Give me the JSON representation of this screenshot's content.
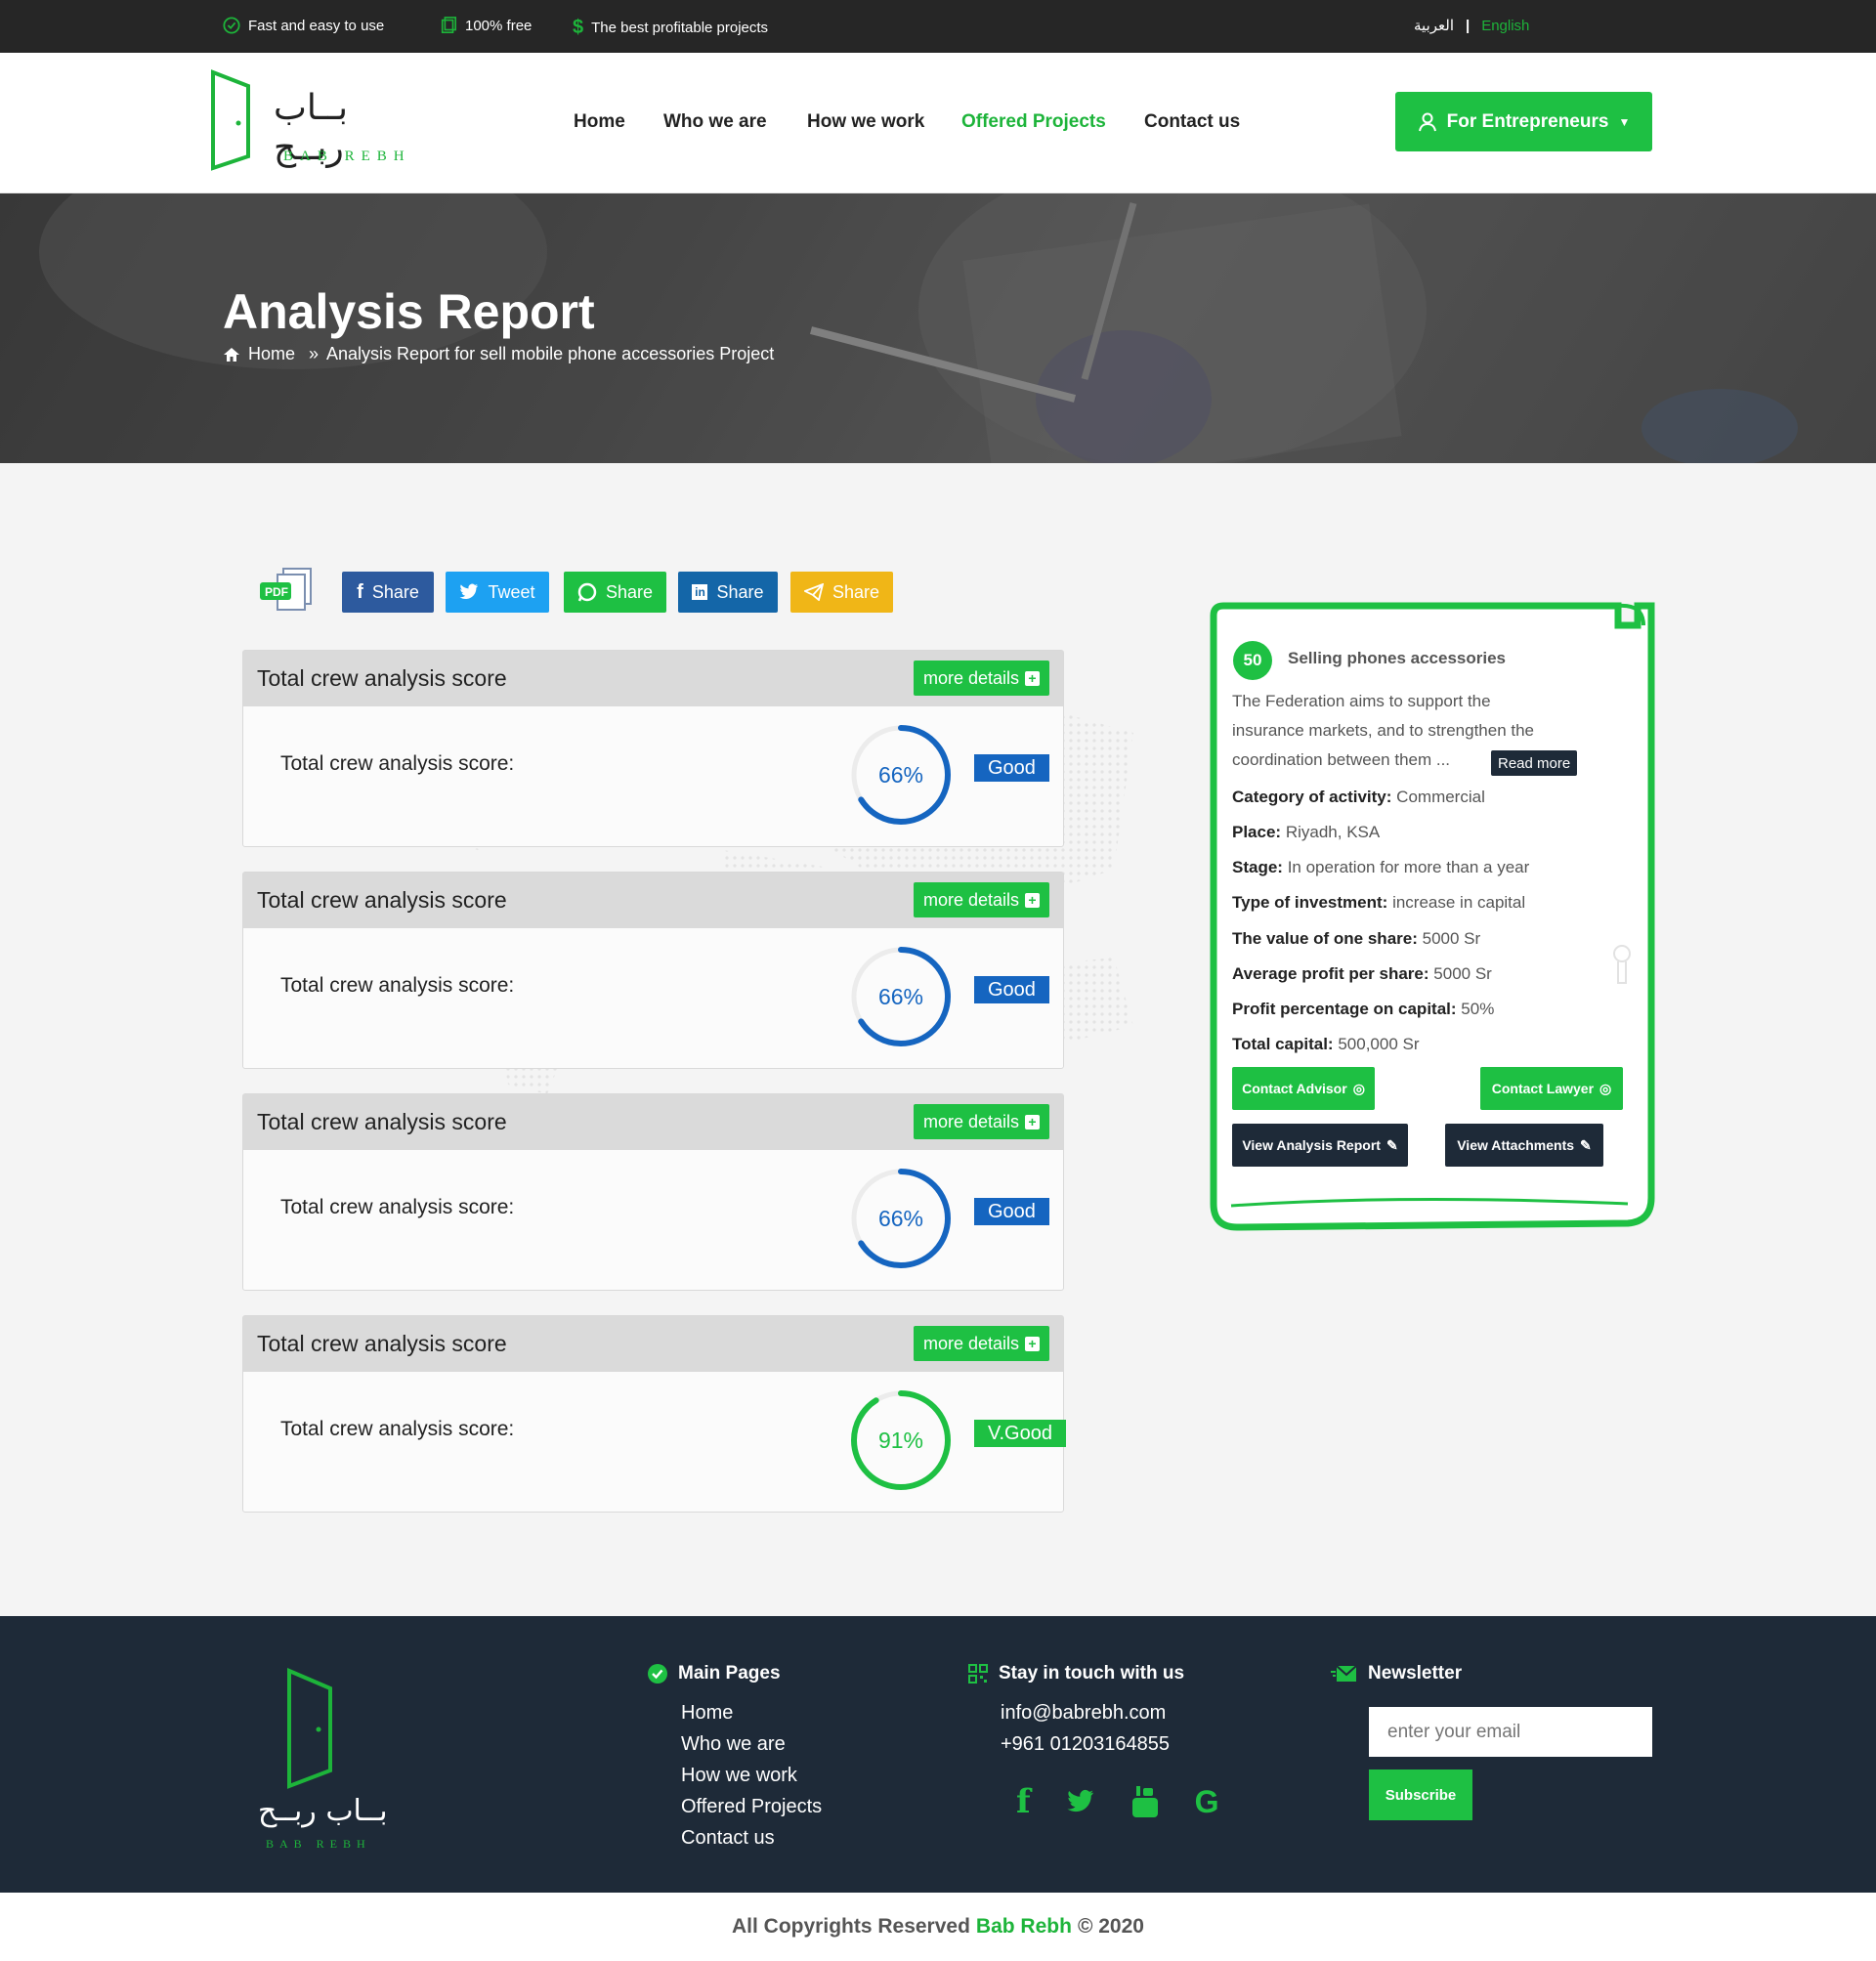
{
  "topbar": {
    "feature1": "Fast and easy to use",
    "feature2": "100% free",
    "feature3": "The best profitable projects",
    "lang_ar": "العربية",
    "lang_sep": "|",
    "lang_en": "English"
  },
  "brand": {
    "name_ar": "بــاب ربــح",
    "name_en": "BAB REBH"
  },
  "nav": {
    "home": "Home",
    "who": "Who we are",
    "how": "How we work",
    "offered": "Offered Projects",
    "contact": "Contact us",
    "cta": "For Entrepreneurs"
  },
  "hero": {
    "title": "Analysis Report",
    "crumb_home": "Home",
    "crumb_current": "Analysis Report for sell mobile phone accessories Project"
  },
  "share": {
    "pdf": "PDF",
    "facebook": "Share",
    "twitter": "Tweet",
    "whatsapp": "Share",
    "linkedin": "Share",
    "telegram": "Share"
  },
  "cards": [
    {
      "title": "Total crew analysis score",
      "more": "more details",
      "label": "Total crew analysis score:",
      "score": "66%",
      "value": 0.66,
      "rating": "Good"
    },
    {
      "title": "Total crew analysis score",
      "more": "more details",
      "label": "Total crew analysis score:",
      "score": "66%",
      "value": 0.66,
      "rating": "Good"
    },
    {
      "title": "Total crew analysis score",
      "more": "more details",
      "label": "Total crew analysis score:",
      "score": "66%",
      "value": 0.66,
      "rating": "Good"
    },
    {
      "title": "Total crew analysis score",
      "more": "more details",
      "label": "Total crew analysis score:",
      "score": "91%",
      "value": 0.91,
      "rating": "V.Good"
    }
  ],
  "project": {
    "number": "50",
    "name": "Selling phones accessories",
    "desc1": "The Federation aims to support the",
    "desc2": "insurance markets, and to strengthen the",
    "desc3": "coordination between them ...",
    "read_more": "Read more",
    "category_label": "Category of activity:",
    "category": "Commercial",
    "place_label": "Place:",
    "place": "Riyadh, KSA",
    "stage_label": "Stage:",
    "stage": "In operation for more than a year",
    "invest_label": "Type of investment:",
    "invest": "increase in capital",
    "share_label": "The value of one share:",
    "share_value": "5000 Sr",
    "profit_label": "Average profit per share:",
    "profit": "5000 Sr",
    "pct_label": "Profit percentage on capital:",
    "pct": "50%",
    "capital_label": "Total capital:",
    "capital": "500,000 Sr",
    "btn_advisor": "Contact Advisor",
    "btn_lawyer": "Contact Lawyer",
    "btn_report": "View Analysis Report",
    "btn_attach": "View Attachments"
  },
  "footer": {
    "main_pages": "Main Pages",
    "links": [
      "Home",
      "Who we are",
      "How we work",
      "Offered Projects",
      "Contact us"
    ],
    "touch": "Stay in touch with us",
    "email": "info@babrebh.com",
    "phone": "+961 01203164855",
    "newsletter": "Newsletter",
    "email_placeholder": "enter your email",
    "subscribe": "Subscribe"
  },
  "copyright": {
    "prefix": "All Copyrights Reserved",
    "brand": "Bab Rebh",
    "suffix": "© 2020"
  },
  "colors": {
    "green": "#1ec043",
    "dark": "#1e2a38",
    "blue": "#1565c0"
  }
}
